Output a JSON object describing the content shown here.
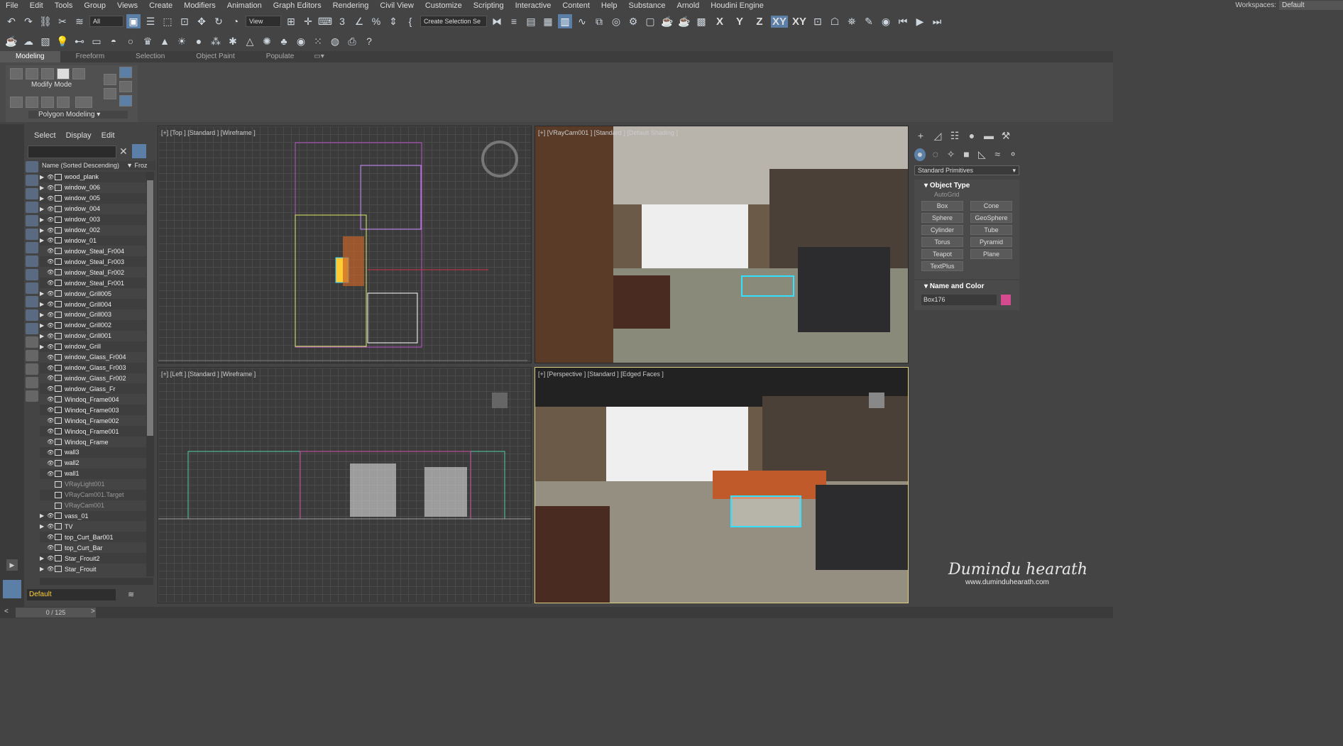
{
  "menu": [
    "File",
    "Edit",
    "Tools",
    "Group",
    "Views",
    "Create",
    "Modifiers",
    "Animation",
    "Graph Editors",
    "Rendering",
    "Civil View",
    "Customize",
    "Scripting",
    "Interactive",
    "Content",
    "Help",
    "Substance",
    "Arnold",
    "Houdini Engine"
  ],
  "workspace": {
    "label": "Workspaces:",
    "value": "Default"
  },
  "toolbar": {
    "filter": "All",
    "refcoord": "View",
    "selset": "Create Selection Se",
    "axes": [
      "X",
      "Y",
      "Z",
      "XY",
      "XY"
    ]
  },
  "ribbon": {
    "tabs": [
      "Modeling",
      "Freeform",
      "Selection",
      "Object Paint",
      "Populate"
    ],
    "modify_mode": "Modify Mode",
    "polygon_modeling": "Polygon Modeling"
  },
  "scene": {
    "tabs": [
      "Select",
      "Display",
      "Edit"
    ],
    "col_name": "Name (Sorted Descending)",
    "col_froz": "Froz",
    "rows": [
      {
        "n": "wood_plank",
        "e": true
      },
      {
        "n": "window_006",
        "e": true
      },
      {
        "n": "window_005",
        "e": true
      },
      {
        "n": "window_004",
        "e": true
      },
      {
        "n": "window_003",
        "e": true
      },
      {
        "n": "window_002",
        "e": true
      },
      {
        "n": "window_01",
        "e": true
      },
      {
        "n": "window_Steal_Fr004",
        "e": false
      },
      {
        "n": "window_Steal_Fr003",
        "e": false
      },
      {
        "n": "window_Steal_Fr002",
        "e": false
      },
      {
        "n": "window_Steal_Fr001",
        "e": false
      },
      {
        "n": "window_Grill005",
        "e": true
      },
      {
        "n": "window_Grill004",
        "e": true
      },
      {
        "n": "window_Grill003",
        "e": true
      },
      {
        "n": "window_Grill002",
        "e": true
      },
      {
        "n": "window_Grill001",
        "e": true
      },
      {
        "n": "window_Grill",
        "e": true
      },
      {
        "n": "window_Glass_Fr004",
        "e": false
      },
      {
        "n": "window_Glass_Fr003",
        "e": false
      },
      {
        "n": "window_Glass_Fr002",
        "e": false
      },
      {
        "n": "window_Glass_Fr",
        "e": false
      },
      {
        "n": "Windoq_Frame004",
        "e": false
      },
      {
        "n": "Windoq_Frame003",
        "e": false
      },
      {
        "n": "Windoq_Frame002",
        "e": false
      },
      {
        "n": "Windoq_Frame001",
        "e": false
      },
      {
        "n": "Windoq_Frame",
        "e": false
      },
      {
        "n": "wall3",
        "e": false
      },
      {
        "n": "wall2",
        "e": false
      },
      {
        "n": "wall1",
        "e": false
      },
      {
        "n": "VRayLight001",
        "e": false,
        "dim": true
      },
      {
        "n": "VRayCam001.Target",
        "e": false,
        "dim": true
      },
      {
        "n": "VRayCam001",
        "e": false,
        "dim": true
      },
      {
        "n": "vass_01",
        "e": true
      },
      {
        "n": "TV",
        "e": true
      },
      {
        "n": "top_Curt_Bar001",
        "e": false
      },
      {
        "n": "top_Curt_Bar",
        "e": false
      },
      {
        "n": "Star_Frouit2",
        "e": true
      },
      {
        "n": "Star_Frouit",
        "e": true
      }
    ],
    "layer": "Default"
  },
  "timeline": {
    "frame": "0 / 125"
  },
  "viewports": {
    "top": "[+] [Top ] [Standard ] [Wireframe ]",
    "cam": "[+] [VRayCam001 ] [Standard ] [Default Shading ]",
    "left": "[+] [Left ] [Standard ] [Wireframe ]",
    "persp": "[+] [Perspective ] [Standard ] [Edged Faces ]"
  },
  "command": {
    "dropdown": "Standard Primitives",
    "object_type": "Object Type",
    "autogrid": "AutoGrid",
    "buttons": [
      "Box",
      "Cone",
      "Sphere",
      "GeoSphere",
      "Cylinder",
      "Tube",
      "Torus",
      "Pyramid",
      "Teapot",
      "Plane",
      "TextPlus"
    ],
    "name_color": "Name and Color",
    "name": "Box176",
    "swatch": "#d64a8f"
  },
  "watermark": {
    "sig": "Dumindu hearath",
    "url": "www.duminduhearath.com"
  }
}
